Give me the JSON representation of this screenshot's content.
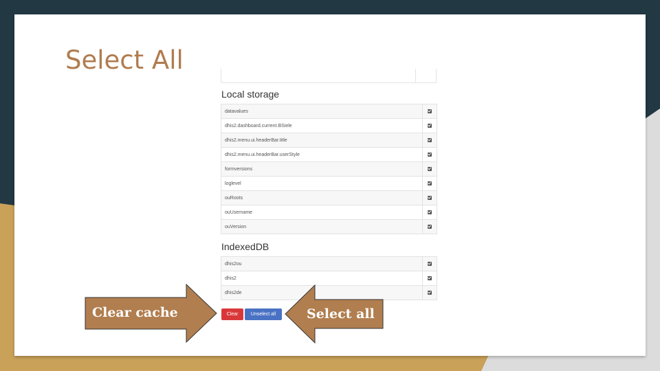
{
  "slide": {
    "title": "Select All"
  },
  "local_storage": {
    "heading": "Local storage",
    "rows": [
      {
        "key": "datavalues",
        "checked": true
      },
      {
        "key": "dhis2.dashboard.current.BSiele",
        "checked": true
      },
      {
        "key": "dhis2.menu.ui.headerBar.title",
        "checked": true
      },
      {
        "key": "dhis2.menu.ui.headerBar.userStyle",
        "checked": true
      },
      {
        "key": "formversions",
        "checked": true
      },
      {
        "key": "loglevel",
        "checked": true
      },
      {
        "key": "ouRoots",
        "checked": true
      },
      {
        "key": "ouUsername",
        "checked": true
      },
      {
        "key": "ouVersion",
        "checked": true
      }
    ]
  },
  "indexed_db": {
    "heading": "IndexedDB",
    "rows": [
      {
        "key": "dhis2ou",
        "checked": true
      },
      {
        "key": "dhis2",
        "checked": true
      },
      {
        "key": "dhis2de",
        "checked": true
      }
    ]
  },
  "buttons": {
    "clear": "Clear",
    "unselect_all": "Unselect all"
  },
  "annotations": {
    "clear_cache": "Clear cache",
    "select_all": "Select all"
  },
  "colors": {
    "background_dark": "#223843",
    "background_gold": "#c9a159",
    "title": "#b07c4f",
    "arrow_fill": "#b17e4f",
    "clear_button": "#d9383a",
    "unselect_button": "#4a72c4"
  }
}
